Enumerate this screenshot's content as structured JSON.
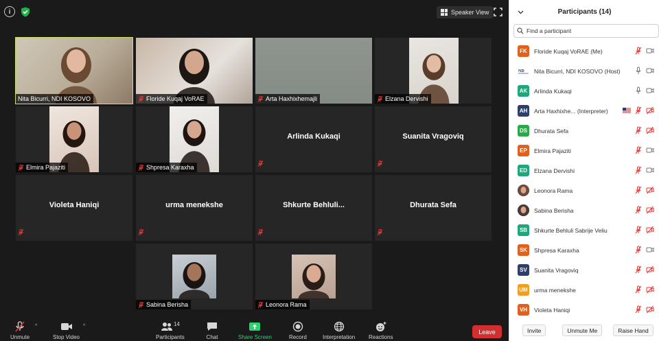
{
  "meeting": {
    "speaker_view_label": "Speaker View",
    "tiles": [
      {
        "name": "Nita Bicurri, NDI KOSOVO",
        "video": true,
        "active": true,
        "muted": false
      },
      {
        "name": "Floride Kuqaj VoRAE",
        "video": true,
        "active": false,
        "muted": true
      },
      {
        "name": "Arta Haxhixhemajli",
        "video": true,
        "active": false,
        "muted": true
      },
      {
        "name": "Elzana Dervishi",
        "video": true,
        "active": false,
        "muted": true
      },
      {
        "name": "Elmira Pajaziti",
        "video": true,
        "active": false,
        "muted": true
      },
      {
        "name": "Shpresa Karaxha",
        "video": true,
        "active": false,
        "muted": true
      },
      {
        "name": "Arlinda Kukaqi",
        "video": false,
        "active": false,
        "muted": true
      },
      {
        "name": "Suanita Vragoviq",
        "video": false,
        "active": false,
        "muted": true
      },
      {
        "name": "Violeta Haniqi",
        "video": false,
        "active": false,
        "muted": true
      },
      {
        "name": "urma menekshe",
        "video": false,
        "active": false,
        "muted": true
      },
      {
        "name": "Shkurte  Behluli...",
        "video": false,
        "active": false,
        "muted": true
      },
      {
        "name": "Dhurata Sefa",
        "video": false,
        "active": false,
        "muted": true
      },
      {
        "name": "Sabina Berisha",
        "video": true,
        "active": false,
        "muted": true
      },
      {
        "name": "Leonora Rama",
        "video": true,
        "active": false,
        "muted": true
      }
    ]
  },
  "toolbar": {
    "unmute_label": "Unmute",
    "stop_video_label": "Stop Video",
    "participants_label": "Participants",
    "participants_count": "14",
    "chat_label": "Chat",
    "share_screen_label": "Share Screen",
    "record_label": "Record",
    "interpretation_label": "Interpretation",
    "reactions_label": "Reactions",
    "leave_label": "Leave"
  },
  "panel": {
    "title": "Participants (14)",
    "search_placeholder": "Find a participant",
    "participants": [
      {
        "initials": "FK",
        "name": "Floride Kuqaj VoRAE (Me)",
        "color": "#e0611f",
        "avatar_type": "initials",
        "mic": "muted",
        "cam": "on"
      },
      {
        "initials": "",
        "name": "Nita Bicurri, NDI KOSOVO (Host)",
        "color": "#ffffff",
        "avatar_type": "logo",
        "mic": "on",
        "cam": "on"
      },
      {
        "initials": "AK",
        "name": "Arlinda Kukaqi",
        "color": "#1fa67a",
        "avatar_type": "initials",
        "mic": "on",
        "cam": "on"
      },
      {
        "initials": "AH",
        "name": "Arta Haxhixhe...  (Interpreter)",
        "color": "#2f3f6b",
        "avatar_type": "initials",
        "mic": "muted",
        "cam": "off",
        "flag": true
      },
      {
        "initials": "DS",
        "name": "Dhurata Sefa",
        "color": "#2ba84a",
        "avatar_type": "initials",
        "mic": "muted",
        "cam": "off"
      },
      {
        "initials": "EP",
        "name": "Elmira Pajaziti",
        "color": "#e0611f",
        "avatar_type": "initials",
        "mic": "muted",
        "cam": "on"
      },
      {
        "initials": "ED",
        "name": "Elzana Dervishi",
        "color": "#1fa67a",
        "avatar_type": "initials",
        "mic": "muted",
        "cam": "on"
      },
      {
        "initials": "",
        "name": "Leonora Rama",
        "color": "#6b4a3a",
        "avatar_type": "photo",
        "mic": "muted",
        "cam": "off"
      },
      {
        "initials": "",
        "name": "Sabina Berisha",
        "color": "#4a3a33",
        "avatar_type": "photo",
        "mic": "muted",
        "cam": "off"
      },
      {
        "initials": "SB",
        "name": "Shkurte Behluli  Sabrije Veliu",
        "color": "#1fa67a",
        "avatar_type": "initials",
        "mic": "muted",
        "cam": "off"
      },
      {
        "initials": "SK",
        "name": "Shpresa Karaxha",
        "color": "#e0611f",
        "avatar_type": "initials",
        "mic": "muted",
        "cam": "on"
      },
      {
        "initials": "SV",
        "name": "Suanita Vragoviq",
        "color": "#2f3f6b",
        "avatar_type": "initials",
        "mic": "muted",
        "cam": "off"
      },
      {
        "initials": "UM",
        "name": "urma menekshe",
        "color": "#f0a020",
        "avatar_type": "initials",
        "mic": "muted",
        "cam": "off"
      },
      {
        "initials": "VH",
        "name": "Violeta Haniqi",
        "color": "#e0611f",
        "avatar_type": "initials",
        "mic": "muted",
        "cam": "off"
      }
    ],
    "invite_label": "Invite",
    "unmute_me_label": "Unmute Me",
    "raise_hand_label": "Raise Hand"
  }
}
